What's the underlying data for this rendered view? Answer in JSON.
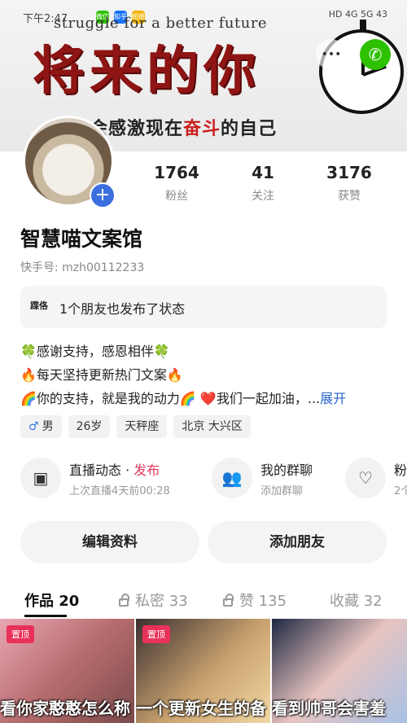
{
  "status_bar": {
    "time": "下午2:47",
    "apps": [
      "微信",
      "知乎",
      "相册"
    ],
    "right": "HD 4G 5G 43"
  },
  "banner": {
    "top_text": "struggle for a better future",
    "headline": "将来的你",
    "sub_before": "会感激现在",
    "sub_highlight": "奋斗",
    "sub_after": "的自己"
  },
  "profile": {
    "name": "智慧喵文案馆",
    "kuaishou_id": "快手号: mzh00112233",
    "stats": [
      {
        "value": "1764",
        "label": "粉丝"
      },
      {
        "value": "41",
        "label": "关注"
      },
      {
        "value": "3176",
        "label": "获赞"
      }
    ]
  },
  "friend_status": {
    "icon_text": "蹀佫",
    "text": "1个朋友也发布了状态"
  },
  "bio": {
    "line1": "🍀感谢支持，感恩相伴🍀",
    "line2": "🔥每天坚持更新热门文案🔥",
    "line3": "🌈你的支持，就是我的动力🌈 ❤️我们一起加油，...",
    "expand": "展开"
  },
  "tags": [
    {
      "icon": "♂",
      "label": "男"
    },
    {
      "label": "26岁"
    },
    {
      "label": "天秤座"
    },
    {
      "label": "北京 大兴区"
    }
  ],
  "features": {
    "live": {
      "title": "直播动态",
      "dot": " · ",
      "action": "发布",
      "subtitle": "上次直播4天前00:28"
    },
    "group": {
      "title": "我的群聊",
      "subtitle": "添加群聊"
    },
    "fans": {
      "title": "粉",
      "subtitle": "2个"
    }
  },
  "buttons": {
    "edit": "编辑资料",
    "add_friend": "添加朋友"
  },
  "tabs": [
    {
      "label": "作品",
      "count": "20"
    },
    {
      "label": "私密",
      "count": "33"
    },
    {
      "label": "赞",
      "count": "135"
    },
    {
      "label": "收藏",
      "count": "32"
    }
  ],
  "videos": [
    {
      "badge": "置顶",
      "caption": "看你家憨憨怎么称"
    },
    {
      "badge": "置顶",
      "caption": "一个更新女生的备"
    },
    {
      "caption": "看到帅哥会害羞"
    }
  ],
  "colors": {
    "accent_red": "#e03b5c",
    "link_blue": "#2b66c8",
    "plus_blue": "#3b6fe0",
    "wechat_green": "#2dc100",
    "badge_red": "#e9325a"
  }
}
